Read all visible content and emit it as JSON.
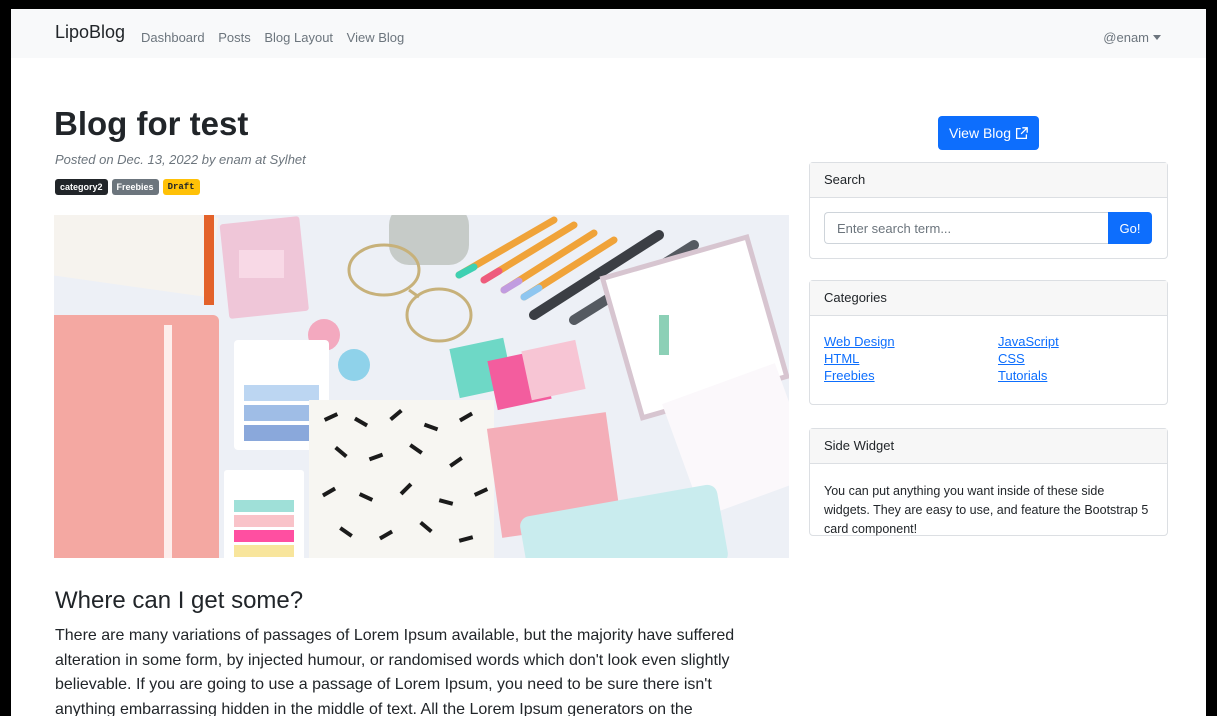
{
  "navbar": {
    "brand": "LipoBlog",
    "links": [
      "Dashboard",
      "Posts",
      "Blog Layout",
      "View Blog"
    ],
    "user": "@enam"
  },
  "post": {
    "title": "Blog for test",
    "meta": "Posted on Dec. 13, 2022 by enam at Sylhet",
    "badges": [
      "category2",
      "Freebies",
      "Draft"
    ],
    "section_heading": "Where can I get some?",
    "paragraph_lines": [
      "There are many variations of passages of Lorem Ipsum available, but the majority have suffered",
      "alteration in some form, by injected humour, or randomised words which don't look even slightly",
      "believable. If you are going to use a passage of Lorem Ipsum, you need to be sure there isn't",
      "anything embarrassing hidden in the middle of text. All the Lorem Ipsum generators on the"
    ]
  },
  "sidebar": {
    "view_blog_label": "View Blog",
    "search": {
      "header": "Search",
      "placeholder": "Enter search term...",
      "button": "Go!"
    },
    "categories": {
      "header": "Categories",
      "items": [
        "Web Design",
        "HTML",
        "Freebies",
        "JavaScript",
        "CSS",
        "Tutorials"
      ]
    },
    "widget": {
      "header": "Side Widget",
      "text": "You can put anything you want inside of these side widgets. They are easy to use, and feature the Bootstrap 5 card component!"
    }
  },
  "colors": {
    "primary": "#0d6efd",
    "dark_badge": "#212529",
    "secondary_badge": "#6c757d",
    "warning_badge": "#ffc107"
  }
}
